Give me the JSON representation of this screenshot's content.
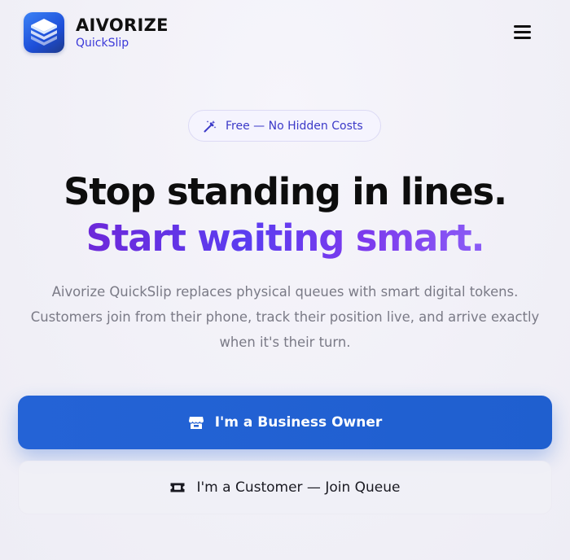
{
  "brand": {
    "name": "AIVORIZE",
    "product": "QuickSlip",
    "logo_icon": "stacked-layers-icon",
    "logo_color": "#2563eb"
  },
  "header": {
    "menu_icon": "hamburger-menu-icon"
  },
  "badge": {
    "icon": "magic-wand-icon",
    "text": "Free — No Hidden Costs"
  },
  "hero": {
    "title_line1": "Stop standing in lines.",
    "title_line2": "Start waiting smart.",
    "description": "Aivorize QuickSlip replaces physical queues with smart digital tokens. Customers join from their phone, track their position live, and arrive exactly when it's their turn."
  },
  "actions": {
    "business": {
      "icon": "storefront-icon",
      "label": "I'm a Business Owner",
      "color": "#2463d6"
    },
    "customer": {
      "icon": "ticket-icon",
      "label": "I'm a Customer — Join Queue"
    }
  },
  "colors": {
    "accent_purple": "#6d28d9",
    "badge_text": "#3b39c8",
    "primary_button": "#2463d6"
  }
}
